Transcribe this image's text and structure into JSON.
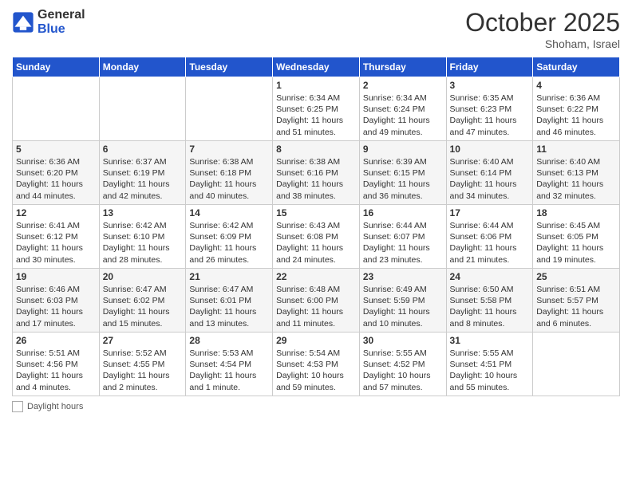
{
  "header": {
    "logo_general": "General",
    "logo_blue": "Blue",
    "month_title": "October 2025",
    "location": "Shoham, Israel"
  },
  "footer": {
    "daylight_hours_label": "Daylight hours"
  },
  "days_of_week": [
    "Sunday",
    "Monday",
    "Tuesday",
    "Wednesday",
    "Thursday",
    "Friday",
    "Saturday"
  ],
  "weeks": [
    [
      {
        "day": "",
        "info": ""
      },
      {
        "day": "",
        "info": ""
      },
      {
        "day": "",
        "info": ""
      },
      {
        "day": "1",
        "info": "Sunrise: 6:34 AM\nSunset: 6:25 PM\nDaylight: 11 hours\nand 51 minutes."
      },
      {
        "day": "2",
        "info": "Sunrise: 6:34 AM\nSunset: 6:24 PM\nDaylight: 11 hours\nand 49 minutes."
      },
      {
        "day": "3",
        "info": "Sunrise: 6:35 AM\nSunset: 6:23 PM\nDaylight: 11 hours\nand 47 minutes."
      },
      {
        "day": "4",
        "info": "Sunrise: 6:36 AM\nSunset: 6:22 PM\nDaylight: 11 hours\nand 46 minutes."
      }
    ],
    [
      {
        "day": "5",
        "info": "Sunrise: 6:36 AM\nSunset: 6:20 PM\nDaylight: 11 hours\nand 44 minutes."
      },
      {
        "day": "6",
        "info": "Sunrise: 6:37 AM\nSunset: 6:19 PM\nDaylight: 11 hours\nand 42 minutes."
      },
      {
        "day": "7",
        "info": "Sunrise: 6:38 AM\nSunset: 6:18 PM\nDaylight: 11 hours\nand 40 minutes."
      },
      {
        "day": "8",
        "info": "Sunrise: 6:38 AM\nSunset: 6:16 PM\nDaylight: 11 hours\nand 38 minutes."
      },
      {
        "day": "9",
        "info": "Sunrise: 6:39 AM\nSunset: 6:15 PM\nDaylight: 11 hours\nand 36 minutes."
      },
      {
        "day": "10",
        "info": "Sunrise: 6:40 AM\nSunset: 6:14 PM\nDaylight: 11 hours\nand 34 minutes."
      },
      {
        "day": "11",
        "info": "Sunrise: 6:40 AM\nSunset: 6:13 PM\nDaylight: 11 hours\nand 32 minutes."
      }
    ],
    [
      {
        "day": "12",
        "info": "Sunrise: 6:41 AM\nSunset: 6:12 PM\nDaylight: 11 hours\nand 30 minutes."
      },
      {
        "day": "13",
        "info": "Sunrise: 6:42 AM\nSunset: 6:10 PM\nDaylight: 11 hours\nand 28 minutes."
      },
      {
        "day": "14",
        "info": "Sunrise: 6:42 AM\nSunset: 6:09 PM\nDaylight: 11 hours\nand 26 minutes."
      },
      {
        "day": "15",
        "info": "Sunrise: 6:43 AM\nSunset: 6:08 PM\nDaylight: 11 hours\nand 24 minutes."
      },
      {
        "day": "16",
        "info": "Sunrise: 6:44 AM\nSunset: 6:07 PM\nDaylight: 11 hours\nand 23 minutes."
      },
      {
        "day": "17",
        "info": "Sunrise: 6:44 AM\nSunset: 6:06 PM\nDaylight: 11 hours\nand 21 minutes."
      },
      {
        "day": "18",
        "info": "Sunrise: 6:45 AM\nSunset: 6:05 PM\nDaylight: 11 hours\nand 19 minutes."
      }
    ],
    [
      {
        "day": "19",
        "info": "Sunrise: 6:46 AM\nSunset: 6:03 PM\nDaylight: 11 hours\nand 17 minutes."
      },
      {
        "day": "20",
        "info": "Sunrise: 6:47 AM\nSunset: 6:02 PM\nDaylight: 11 hours\nand 15 minutes."
      },
      {
        "day": "21",
        "info": "Sunrise: 6:47 AM\nSunset: 6:01 PM\nDaylight: 11 hours\nand 13 minutes."
      },
      {
        "day": "22",
        "info": "Sunrise: 6:48 AM\nSunset: 6:00 PM\nDaylight: 11 hours\nand 11 minutes."
      },
      {
        "day": "23",
        "info": "Sunrise: 6:49 AM\nSunset: 5:59 PM\nDaylight: 11 hours\nand 10 minutes."
      },
      {
        "day": "24",
        "info": "Sunrise: 6:50 AM\nSunset: 5:58 PM\nDaylight: 11 hours\nand 8 minutes."
      },
      {
        "day": "25",
        "info": "Sunrise: 6:51 AM\nSunset: 5:57 PM\nDaylight: 11 hours\nand 6 minutes."
      }
    ],
    [
      {
        "day": "26",
        "info": "Sunrise: 5:51 AM\nSunset: 4:56 PM\nDaylight: 11 hours\nand 4 minutes."
      },
      {
        "day": "27",
        "info": "Sunrise: 5:52 AM\nSunset: 4:55 PM\nDaylight: 11 hours\nand 2 minutes."
      },
      {
        "day": "28",
        "info": "Sunrise: 5:53 AM\nSunset: 4:54 PM\nDaylight: 11 hours\nand 1 minute."
      },
      {
        "day": "29",
        "info": "Sunrise: 5:54 AM\nSunset: 4:53 PM\nDaylight: 10 hours\nand 59 minutes."
      },
      {
        "day": "30",
        "info": "Sunrise: 5:55 AM\nSunset: 4:52 PM\nDaylight: 10 hours\nand 57 minutes."
      },
      {
        "day": "31",
        "info": "Sunrise: 5:55 AM\nSunset: 4:51 PM\nDaylight: 10 hours\nand 55 minutes."
      },
      {
        "day": "",
        "info": ""
      }
    ]
  ]
}
